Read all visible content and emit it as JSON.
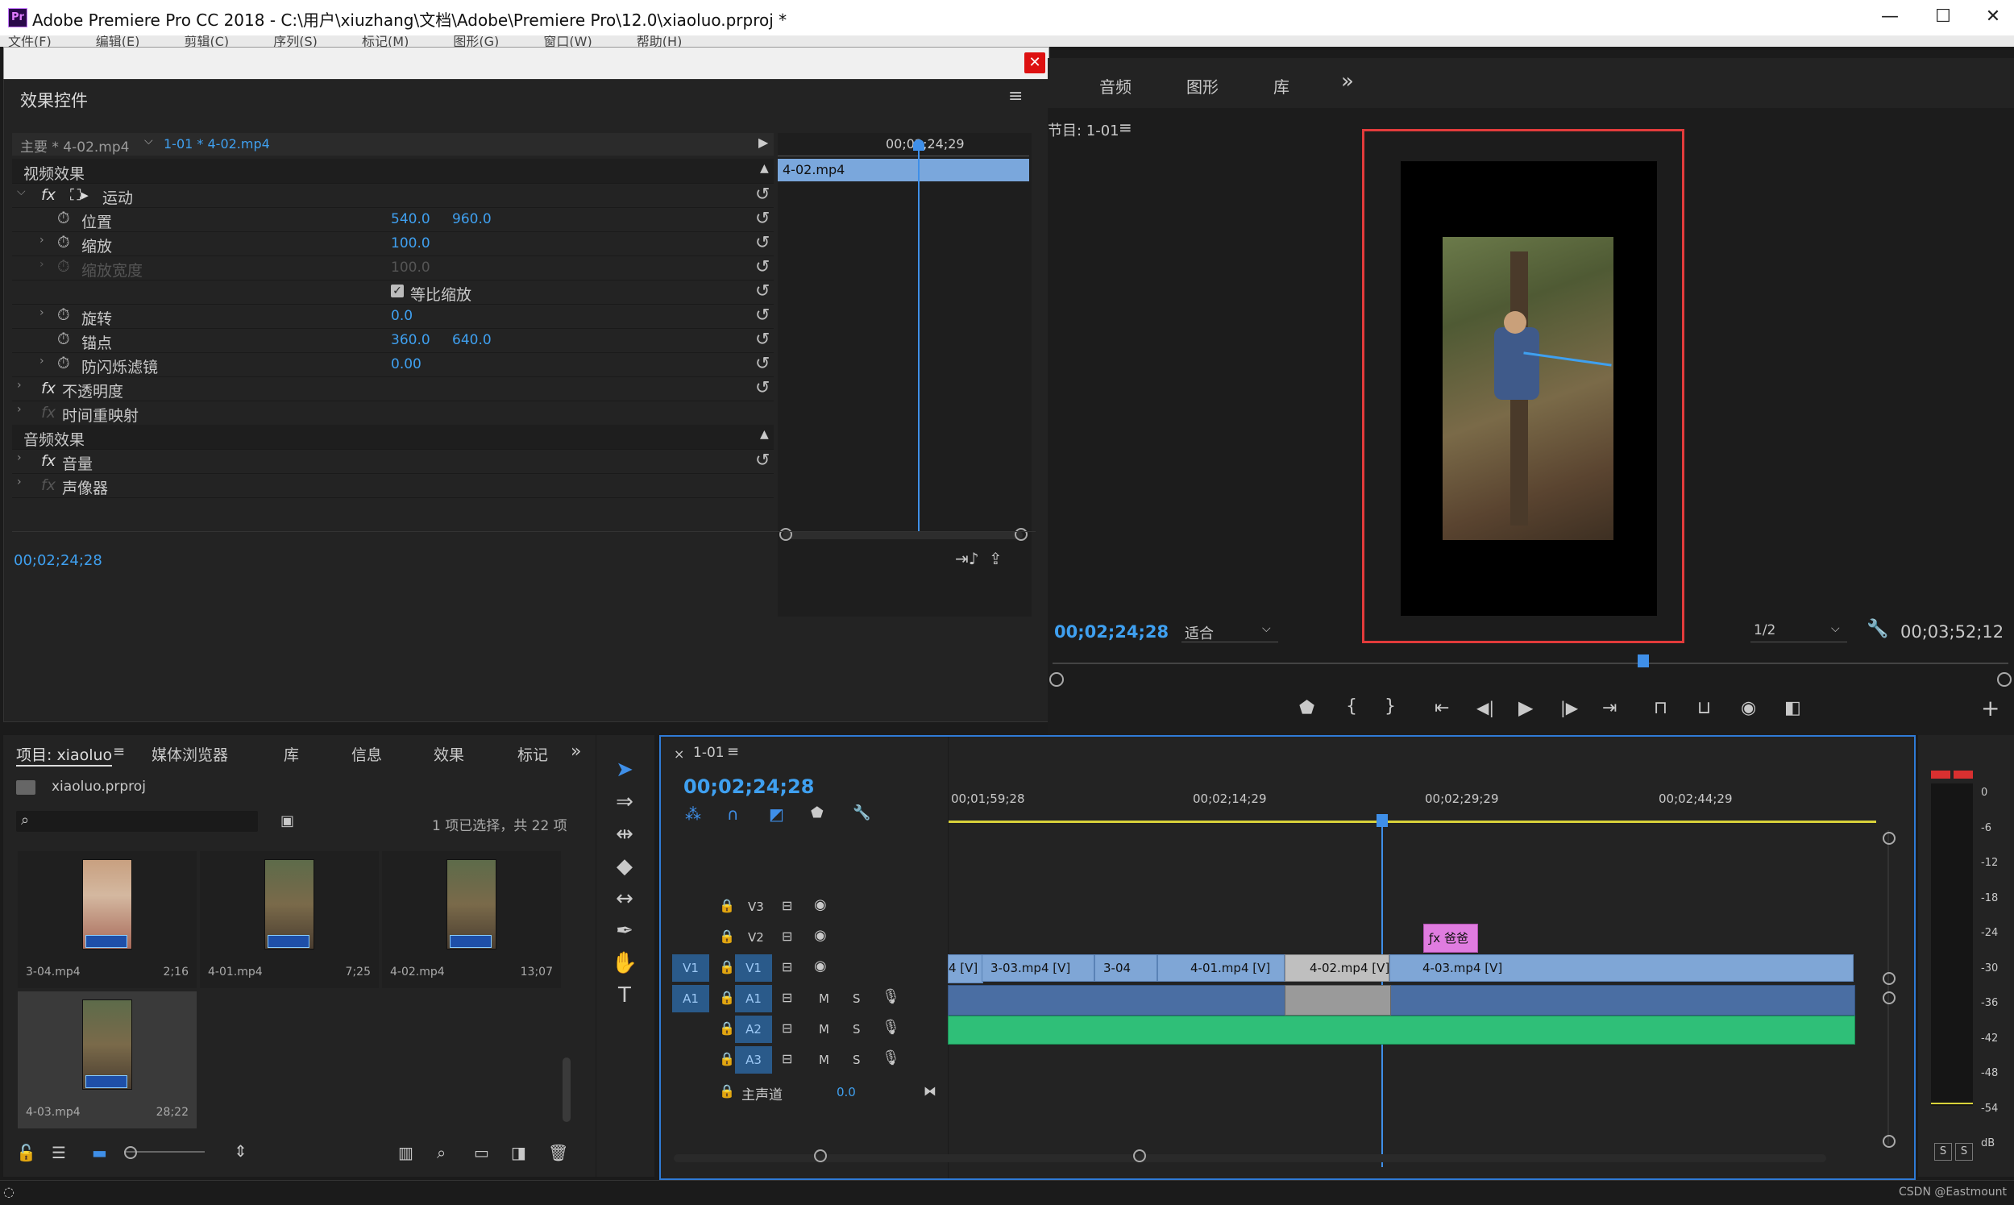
{
  "window": {
    "title": "Adobe Premiere Pro CC 2018 - C:\\用户\\xiuzhang\\文档\\Adobe\\Premiere Pro\\12.0\\xiaoluo.prproj *",
    "logo": "Pr",
    "minimize": "—",
    "maximize": "☐",
    "close": "✕"
  },
  "menu": [
    "文件(F)",
    "编辑(E)",
    "剪辑(C)",
    "序列(S)",
    "标记(M)",
    "图形(G)",
    "窗口(W)",
    "帮助(H)"
  ],
  "effect_controls": {
    "title": "效果控件",
    "master": "主要 * 4-02.mp4",
    "sequence_clip": "1-01 * 4-02.mp4",
    "timecode_top": "00;02;24;29",
    "clip_bar": "4-02.mp4",
    "video_effects": "视频效果",
    "motion": "运动",
    "position_label": "位置",
    "position_x": "540.0",
    "position_y": "960.0",
    "scale_label": "缩放",
    "scale_value": "100.0",
    "scale_width_label": "缩放宽度",
    "scale_width_value": "100.0",
    "uniform_scale": "等比缩放",
    "rotation_label": "旋转",
    "rotation_value": "0.0",
    "anchor_label": "锚点",
    "anchor_x": "360.0",
    "anchor_y": "640.0",
    "antiflicker_label": "防闪烁滤镜",
    "antiflicker_value": "0.00",
    "opacity": "不透明度",
    "time_remap": "时间重映射",
    "audio_effects": "音频效果",
    "volume": "音量",
    "channel_volume": "声像器",
    "fx": "fx",
    "timecode_bottom": "00;02;24;28"
  },
  "program": {
    "tabs": [
      "音频",
      "图形",
      "库"
    ],
    "more": "»",
    "monitor_title": "节目: 1-01",
    "timecode_current": "00;02;24;28",
    "fit": "适合",
    "resolution": "1/2",
    "timecode_duration": "00;03;52;12",
    "add": "+"
  },
  "project": {
    "tabs": [
      "项目: xiaoluo",
      "媒体浏览器",
      "库",
      "信息",
      "效果",
      "标记"
    ],
    "file": "xiaoluo.prproj",
    "selection": "1 项已选择，共 22 项",
    "items": [
      {
        "name": "3-04.mp4",
        "duration": "2;16"
      },
      {
        "name": "4-01.mp4",
        "duration": "7;25"
      },
      {
        "name": "4-02.mp4",
        "duration": "13;07"
      },
      {
        "name": "4-03.mp4",
        "duration": "28;22"
      }
    ]
  },
  "timeline": {
    "sequence": "1-01",
    "timecode": "00;02;24;28",
    "ruler": [
      "00;01;59;28",
      "00;02;14;29",
      "00;02;29;29",
      "00;02;44;29"
    ],
    "video_tracks": [
      "V3",
      "V2",
      "V1"
    ],
    "audio_tracks": [
      "A1",
      "A2",
      "A3"
    ],
    "src_v1": "V1",
    "src_a1": "A1",
    "master_label": "主声道",
    "master_value": "0.0",
    "m": "M",
    "s": "S",
    "clips_v1": [
      "4 [V]",
      "3-03.mp4 [V]",
      "3-04",
      "4-01.mp4 [V]",
      "4-02.mp4 [V]",
      "4-03.mp4 [V]"
    ],
    "clip_v2": "爸爸"
  },
  "meter": {
    "scale": [
      "0",
      "-6",
      "-12",
      "-18",
      "-24",
      "-30",
      "-36",
      "-42",
      "-48",
      "-54",
      "dB"
    ],
    "solo": [
      "S",
      "S"
    ]
  },
  "status": {
    "watermark": "CSDN @Eastmount"
  }
}
